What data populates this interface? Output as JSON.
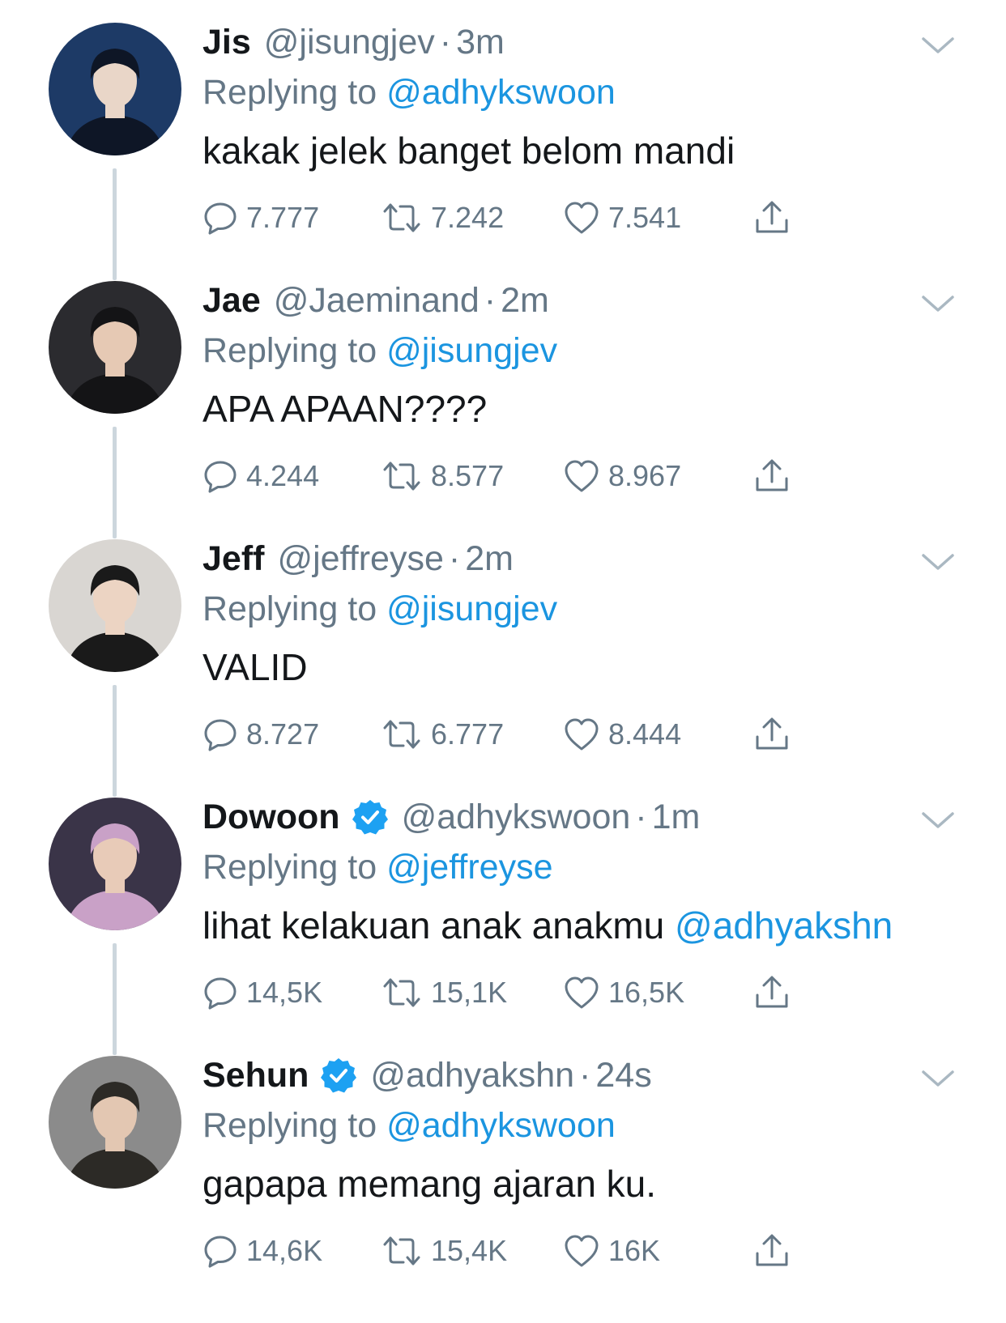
{
  "tweets": [
    {
      "name": "Jis",
      "handle": "@jisungjev",
      "dot": "·",
      "time": "3m",
      "verified": false,
      "replying_prefix": "Replying to",
      "replying_to": "@adhykswoon",
      "text": "kakak jelek banget belom mandi",
      "text_mention": "",
      "replies": "7.777",
      "retweets": "7.242",
      "likes": "7.541",
      "avatar_colors": [
        "#1d3a66",
        "#0e1626",
        "#e9d6c8"
      ]
    },
    {
      "name": "Jae",
      "handle": "@Jaeminand",
      "dot": "·",
      "time": "2m",
      "verified": false,
      "replying_prefix": "Replying to",
      "replying_to": "@jisungjev",
      "text": "APA APAAN????",
      "text_mention": "",
      "replies": "4.244",
      "retweets": "8.577",
      "likes": "8.967",
      "avatar_colors": [
        "#2b2b2f",
        "#141416",
        "#e6c9b4"
      ]
    },
    {
      "name": "Jeff",
      "handle": "@jeffreyse",
      "dot": "·",
      "time": "2m",
      "verified": false,
      "replying_prefix": "Replying to",
      "replying_to": "@jisungjev",
      "text": "VALID",
      "text_mention": "",
      "replies": "8.727",
      "retweets": "6.777",
      "likes": "8.444",
      "avatar_colors": [
        "#d9d6d2",
        "#1a1a1a",
        "#ecd4c3"
      ]
    },
    {
      "name": "Dowoon",
      "handle": "@adhykswoon",
      "dot": "·",
      "time": "1m",
      "verified": true,
      "replying_prefix": "Replying to",
      "replying_to": "@jeffreyse",
      "text": "lihat kelakuan anak anakmu ",
      "text_mention": "@adhyakshn",
      "replies": "14,5K",
      "retweets": "15,1K",
      "likes": "16,5K",
      "avatar_colors": [
        "#3a3448",
        "#c9a1c7",
        "#e8cbb8"
      ]
    },
    {
      "name": "Sehun",
      "handle": "@adhyakshn",
      "dot": "·",
      "time": "24s",
      "verified": true,
      "replying_prefix": "Replying to",
      "replying_to": "@adhykswoon",
      "text": "gapapa memang ajaran ku.",
      "text_mention": "",
      "replies": "14,6K",
      "retweets": "15,4K",
      "likes": "16K",
      "avatar_colors": [
        "#8b8b8b",
        "#2c2a26",
        "#e3c7b2"
      ]
    }
  ],
  "colors": {
    "text": "#14171a",
    "secondary": "#657786",
    "mention": "#1b95e0",
    "thread_line": "#ccd6dd",
    "verified": "#1da1f2"
  },
  "icons": {
    "reply": "reply-icon",
    "retweet": "retweet-icon",
    "like": "heart-icon",
    "share": "share-icon",
    "more": "chevron-down-icon",
    "verified": "verified-badge-icon"
  }
}
